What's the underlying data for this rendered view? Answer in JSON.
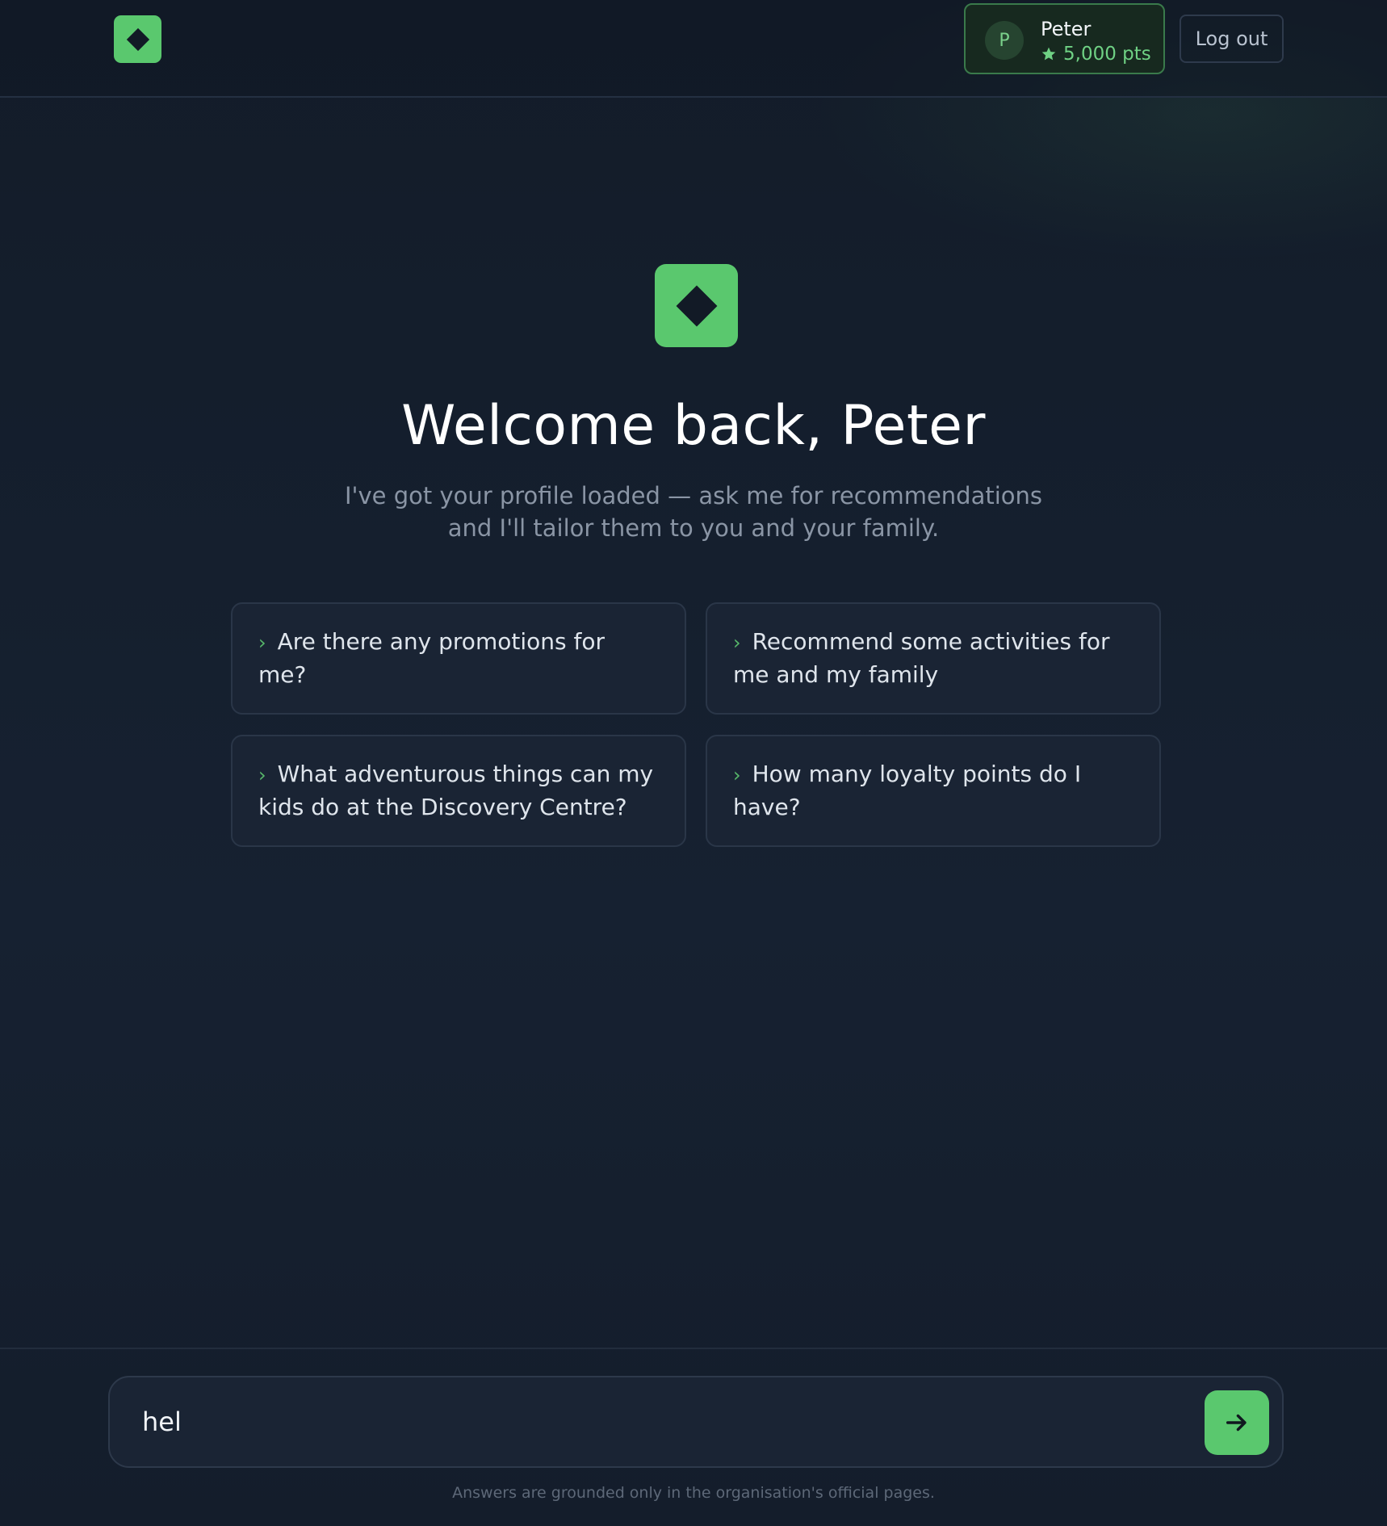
{
  "header": {
    "user": {
      "avatar_initial": "P",
      "name": "Peter",
      "points": "5,000 pts"
    },
    "logout_label": "Log out"
  },
  "hero": {
    "title": "Welcome back, Peter",
    "subtitle_line1": "I've got your profile loaded — ask me for recommendations",
    "subtitle_line2": "and I'll tailor them to you and your family."
  },
  "suggestions": [
    {
      "label": "Are there any promotions for me?",
      "icon": "chevron-right-icon"
    },
    {
      "label": "Recommend some activities for me and my family",
      "icon": "chevron-right-icon"
    },
    {
      "label": "What adventurous things can my kids do at the Discovery Centre?",
      "icon": "chevron-right-icon"
    },
    {
      "label": "How many loyalty points do I have?",
      "icon": "chevron-right-icon"
    }
  ],
  "composer": {
    "value": "hel",
    "send_icon": "arrow-right-icon"
  },
  "footnote": "Answers are grounded only in the organisation's official pages.",
  "colors": {
    "accent": "#5ac86e",
    "background": "#141d2b",
    "card": "#1a2434"
  }
}
